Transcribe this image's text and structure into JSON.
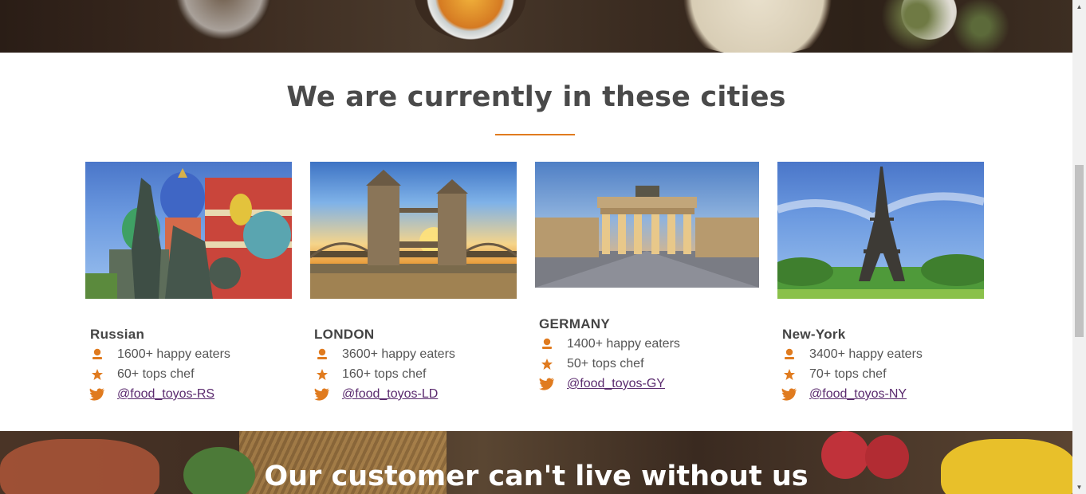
{
  "section": {
    "title": "We are currently in these cities"
  },
  "cities": [
    {
      "name": "Russian",
      "eaters": "1600+ happy eaters",
      "chefs": "60+ tops chef",
      "twitter": "@food_toyos-RS"
    },
    {
      "name": "LONDON",
      "eaters": "3600+ happy eaters",
      "chefs": "160+ tops chef",
      "twitter": "@food_toyos-LD"
    },
    {
      "name": "GERMANY",
      "eaters": "1400+ happy eaters",
      "chefs": "50+ tops chef",
      "twitter": "@food_toyos-GY"
    },
    {
      "name": "New-York",
      "eaters": "3400+ happy eaters",
      "chefs": "70+ tops chef",
      "twitter": "@food_toyos-NY"
    }
  ],
  "icons": {
    "eaters": "person-icon",
    "chefs": "star-icon",
    "twitter": "twitter-icon"
  },
  "colors": {
    "accent": "#e07b1f",
    "heading": "#4a4a4a",
    "link": "#5a2a6e"
  },
  "testimonials": {
    "title": "Our customer can't live without us"
  }
}
